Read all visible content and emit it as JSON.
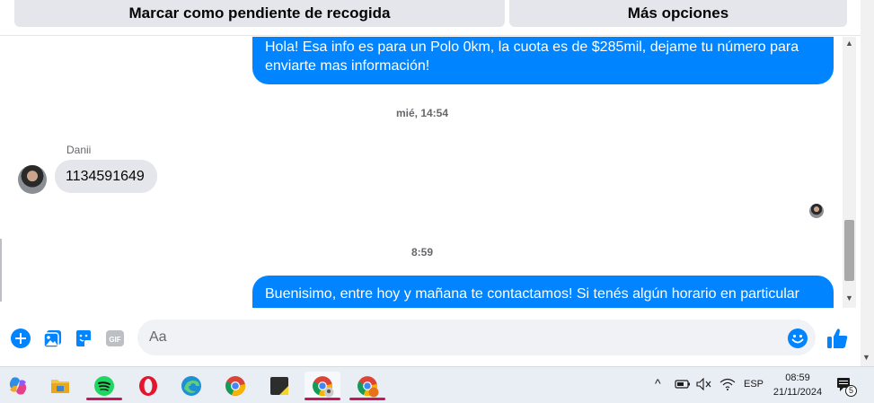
{
  "actions": {
    "pending_label": "Marcar como pendiente de recogida",
    "more_label": "Más opciones"
  },
  "messages": [
    {
      "direction": "out",
      "text": "Hola! Esa info es para un Polo 0km, la cuota es de $285mil, dejame tu número para enviarte mas información!"
    },
    {
      "timestamp": "mié, 14:54"
    },
    {
      "direction": "in",
      "sender": "Danii",
      "text": "1134591649"
    },
    {
      "timestamp": "8:59"
    },
    {
      "direction": "out",
      "text": "Buenisimo, entre hoy y mañana te contactamos! Si tenés algún horario en particular"
    }
  ],
  "composer": {
    "placeholder": "Aa",
    "icons": [
      "plus-icon",
      "gallery-icon",
      "sticker-icon",
      "gif-icon",
      "emoji-icon",
      "like-icon"
    ],
    "gif_label": "GIF"
  },
  "colors": {
    "accent": "#0084ff",
    "incoming_bubble": "#e4e6eb",
    "taskbar": "#e9eef5"
  },
  "taskbar": {
    "apps": [
      "copilot-icon",
      "file-explorer-icon",
      "spotify-icon",
      "opera-icon",
      "edge-icon",
      "chrome-icon",
      "sticky-notes-icon",
      "chrome-profile-icon",
      "chrome-profile-icon"
    ],
    "language": "ESP",
    "time": "08:59",
    "date": "21/11/2024",
    "notification_count": "5"
  }
}
